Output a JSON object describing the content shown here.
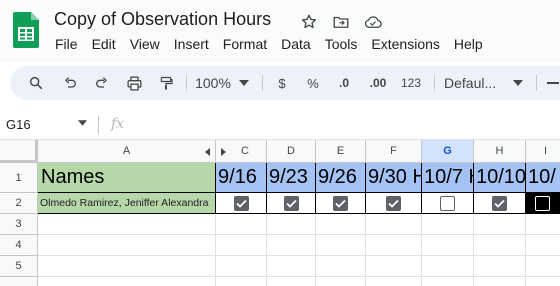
{
  "app": {
    "title": "Copy of Observation Hours",
    "menu": [
      "File",
      "Edit",
      "View",
      "Insert",
      "Format",
      "Data",
      "Tools",
      "Extensions",
      "Help"
    ]
  },
  "toolbar": {
    "zoom": "100%",
    "currency": "$",
    "percent": "%",
    "decrease_decimal": ".0",
    "increase_decimal": ".00",
    "number_format": "123",
    "font": "Defaul..."
  },
  "formula_bar": {
    "cell_ref": "G16",
    "fx": "fx"
  },
  "sheet": {
    "column_headers": [
      "A",
      "C",
      "D",
      "E",
      "F",
      "G",
      "H",
      "I"
    ],
    "selected_column": "G",
    "row_headers": [
      "1",
      "2",
      "3",
      "4",
      "5"
    ],
    "header_row": [
      "Names",
      "9/16",
      "9/23",
      "9/26",
      "9/30 H",
      "10/7 H",
      "10/10 H",
      "10/"
    ],
    "data_rows": [
      {
        "name": "Olmedo Ramirez, Jeniffer Alexandra",
        "checks": [
          true,
          true,
          true,
          true,
          false,
          true,
          false
        ]
      }
    ]
  },
  "colors": {
    "names_fill": "#b6d7a8",
    "dates_fill": "#a4c2f4",
    "selection": "#d3e3fd",
    "checkbox": "#5f6368"
  }
}
